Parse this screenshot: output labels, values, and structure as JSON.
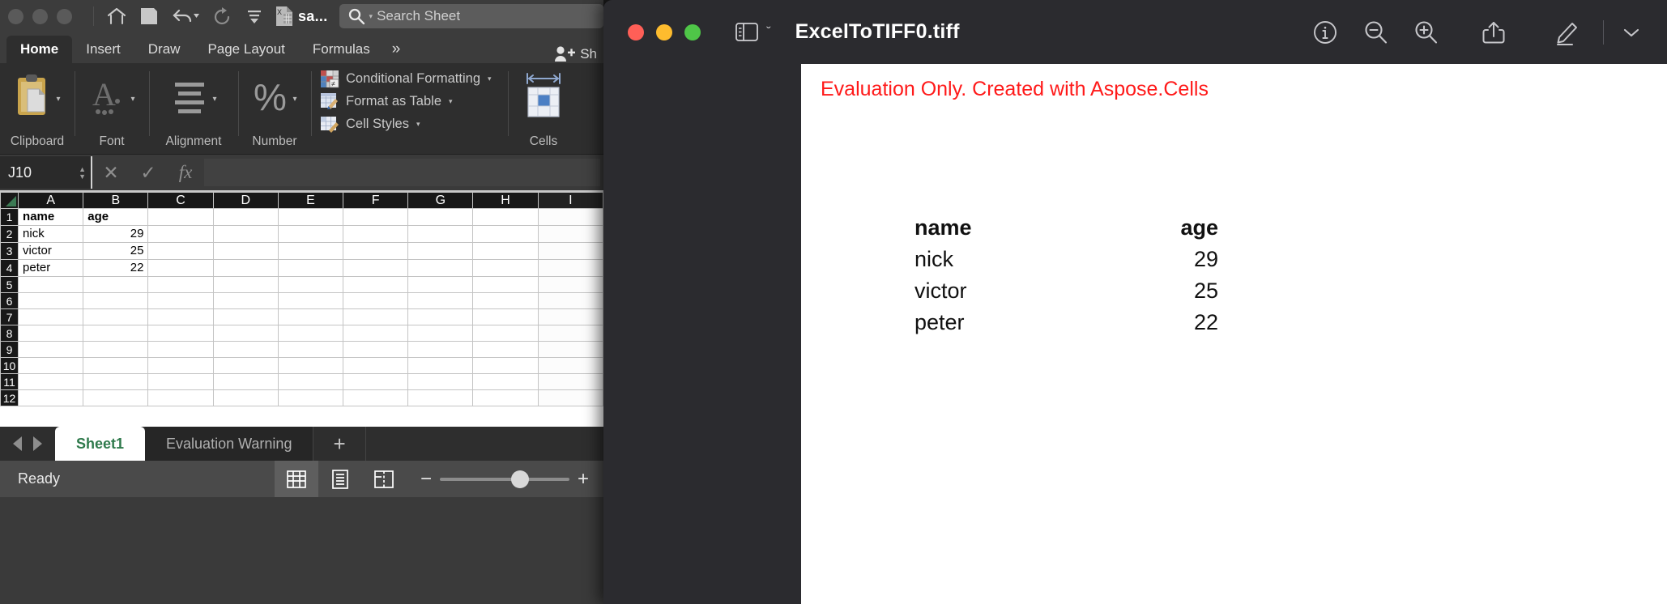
{
  "excel": {
    "quick_access": {
      "home_icon": "home-icon",
      "save_icon": "save-icon",
      "undo_icon": "undo-icon",
      "redo_icon": "redo-icon",
      "customize_icon": "customize-toolbar-icon",
      "file_icon": "excel-file-icon",
      "file_name": "sa...",
      "search_placeholder": "Search Sheet",
      "search_icon": "search-icon"
    },
    "tabs": [
      {
        "label": "Home",
        "active": true
      },
      {
        "label": "Insert",
        "active": false
      },
      {
        "label": "Draw",
        "active": false
      },
      {
        "label": "Page Layout",
        "active": false
      },
      {
        "label": "Formulas",
        "active": false
      }
    ],
    "tabs_overflow": "»",
    "share_label": "Sh",
    "share_icon": "share-person-icon",
    "ribbon_groups": [
      {
        "label": "Clipboard",
        "icon": "clipboard-paste-icon"
      },
      {
        "label": "Font",
        "icon": "font-format-icon"
      },
      {
        "label": "Alignment",
        "icon": "alignment-icon"
      },
      {
        "label": "Number",
        "icon": "percent-icon"
      },
      {
        "label": "Cells",
        "icon": "cells-insert-icon"
      }
    ],
    "styles_group": [
      {
        "label": "Conditional Formatting",
        "icon": "conditional-formatting-icon",
        "caret": "▾"
      },
      {
        "label": "Format as Table",
        "icon": "format-as-table-icon",
        "caret": "▾"
      },
      {
        "label": "Cell Styles",
        "icon": "cell-styles-icon",
        "caret": "▾"
      }
    ],
    "formula_bar": {
      "name_box_value": "J10",
      "cancel_icon": "cancel-x-icon",
      "accept_icon": "accept-check-icon",
      "function_icon": "fx-function-icon",
      "formula_value": ""
    },
    "grid": {
      "columns": [
        "A",
        "B",
        "C",
        "D",
        "E",
        "F",
        "G",
        "H",
        "I"
      ],
      "selected_column": "I",
      "rows": [
        {
          "num": "1",
          "cells": [
            "name",
            "age",
            "",
            "",
            "",
            "",
            "",
            "",
            ""
          ],
          "bold": true
        },
        {
          "num": "2",
          "cells": [
            "nick",
            "29",
            "",
            "",
            "",
            "",
            "",
            "",
            ""
          ],
          "bold": false
        },
        {
          "num": "3",
          "cells": [
            "victor",
            "25",
            "",
            "",
            "",
            "",
            "",
            "",
            ""
          ],
          "bold": false
        },
        {
          "num": "4",
          "cells": [
            "peter",
            "22",
            "",
            "",
            "",
            "",
            "",
            "",
            ""
          ],
          "bold": false
        },
        {
          "num": "5",
          "cells": [
            "",
            "",
            "",
            "",
            "",
            "",
            "",
            "",
            ""
          ],
          "bold": false
        },
        {
          "num": "6",
          "cells": [
            "",
            "",
            "",
            "",
            "",
            "",
            "",
            "",
            ""
          ],
          "bold": false
        },
        {
          "num": "7",
          "cells": [
            "",
            "",
            "",
            "",
            "",
            "",
            "",
            "",
            ""
          ],
          "bold": false
        },
        {
          "num": "8",
          "cells": [
            "",
            "",
            "",
            "",
            "",
            "",
            "",
            "",
            ""
          ],
          "bold": false
        },
        {
          "num": "9",
          "cells": [
            "",
            "",
            "",
            "",
            "",
            "",
            "",
            "",
            ""
          ],
          "bold": false
        },
        {
          "num": "10",
          "cells": [
            "",
            "",
            "",
            "",
            "",
            "",
            "",
            "",
            ""
          ],
          "bold": false
        },
        {
          "num": "11",
          "cells": [
            "",
            "",
            "",
            "",
            "",
            "",
            "",
            "",
            ""
          ],
          "bold": false
        },
        {
          "num": "12",
          "cells": [
            "",
            "",
            "",
            "",
            "",
            "",
            "",
            "",
            ""
          ],
          "bold": false
        }
      ]
    },
    "sheet_tabs": {
      "prev_icon": "previous-sheet-arrow-icon",
      "next_icon": "next-sheet-arrow-icon",
      "tabs": [
        {
          "label": "Sheet1",
          "active": true
        },
        {
          "label": "Evaluation Warning",
          "active": false
        }
      ],
      "add_label": "+"
    },
    "status_bar": {
      "status": "Ready",
      "views": [
        {
          "icon": "normal-view-icon",
          "active": true
        },
        {
          "icon": "page-layout-view-icon",
          "active": false
        },
        {
          "icon": "page-break-view-icon",
          "active": false
        }
      ],
      "zoom_out": "−",
      "zoom_in": "+"
    }
  },
  "preview": {
    "title": "ExcelToTIFF0.tiff",
    "traffic_lights": {
      "close": "#ff5f57",
      "minimize": "#febc2e",
      "zoom": "#4fc648"
    },
    "sidebar_icon": "sidebar-toggle-icon",
    "sidebar_caret": "ˇ",
    "tools": [
      {
        "icon": "info-icon"
      },
      {
        "icon": "zoom-out-icon"
      },
      {
        "icon": "zoom-in-icon"
      },
      {
        "icon": "share-icon"
      },
      {
        "icon": "markup-pen-icon"
      },
      {
        "icon": "chevron-down-icon"
      }
    ],
    "document": {
      "watermark": "Evaluation Only. Created with Aspose.Cells",
      "watermark_color": "#ff1a1a",
      "table": {
        "header": {
          "name": "name",
          "age": "age"
        },
        "rows": [
          {
            "name": "nick",
            "age": "29"
          },
          {
            "name": "victor",
            "age": "25"
          },
          {
            "name": "peter",
            "age": "22"
          }
        ]
      }
    }
  }
}
